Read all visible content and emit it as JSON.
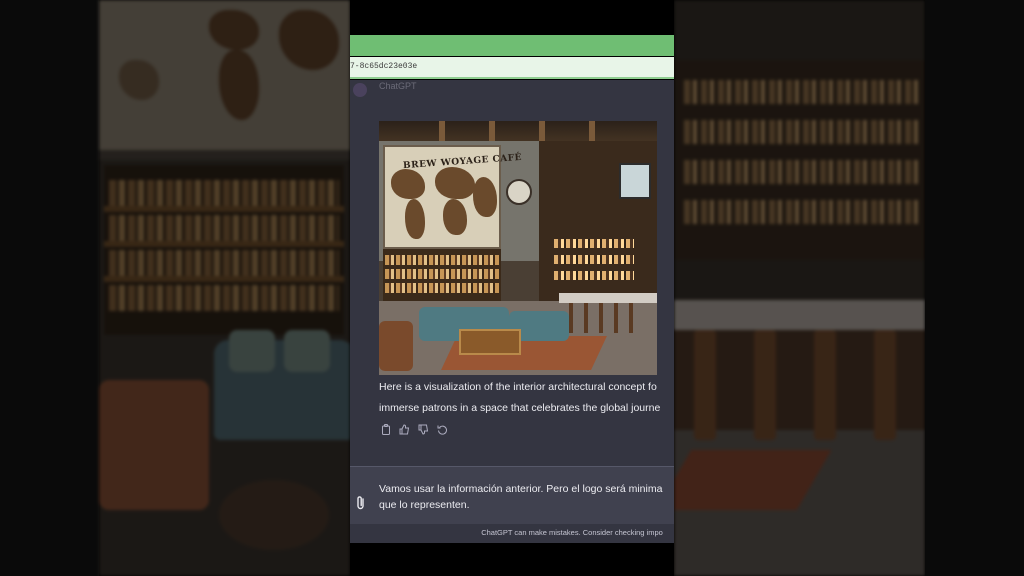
{
  "browser": {
    "url_fragment": "7-8c65dc23e03e"
  },
  "chat": {
    "assistant_name": "ChatGPT",
    "generated_image_sign": "BREW WOYAGE CAFÉ",
    "response_line_1": "Here is a visualization of the interior architectural concept fo",
    "response_line_2": "immerse patrons in a space that celebrates the global journe",
    "actions": [
      "copy-icon",
      "thumbs-up-icon",
      "thumbs-down-icon",
      "regenerate-icon"
    ]
  },
  "composer": {
    "text_line_1": "Vamos usar la información anterior. Pero el logo será minima",
    "text_line_2": "que lo representen.",
    "attach_icon": "paperclip-icon",
    "disclaimer": "ChatGPT can make mistakes. Consider checking impo"
  },
  "colors": {
    "chat_bg": "#343541",
    "composer_bg": "#40414f",
    "browser_bar": "#6fbe73"
  }
}
